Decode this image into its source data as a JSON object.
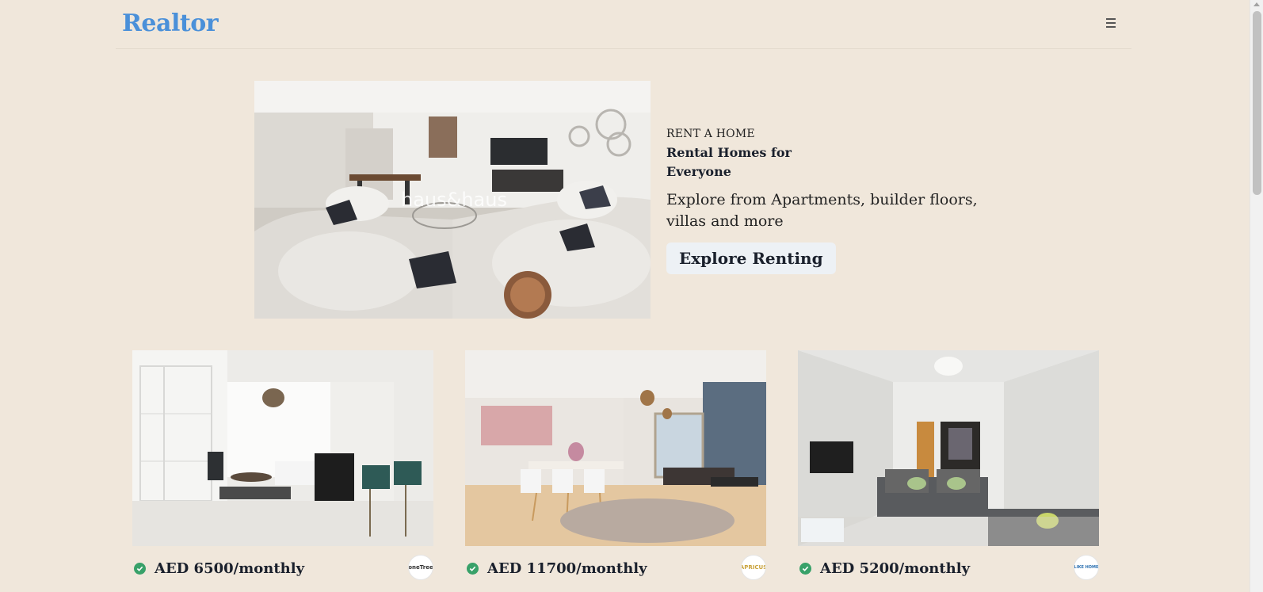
{
  "app": {
    "brand": "Realtor",
    "menu_icon": "hamburger-icon"
  },
  "hero": {
    "eyebrow": "RENT A HOME",
    "title": "Rental Homes for Everyone",
    "description": "Explore from Apartments, builder floors, villas and more",
    "button_label": "Explore Renting",
    "image_watermark": "haus&haus"
  },
  "listings": [
    {
      "price": "AED 6500/monthly",
      "agency": "oneTree",
      "verified": true
    },
    {
      "price": "AED 11700/monthly",
      "agency": "APRICUS",
      "verified": true
    },
    {
      "price": "AED 5200/monthly",
      "agency": "LIKE HOME",
      "verified": true
    }
  ],
  "colors": {
    "background": "#f0e7db",
    "brand": "#4a90d9",
    "verified": "#38a169"
  }
}
